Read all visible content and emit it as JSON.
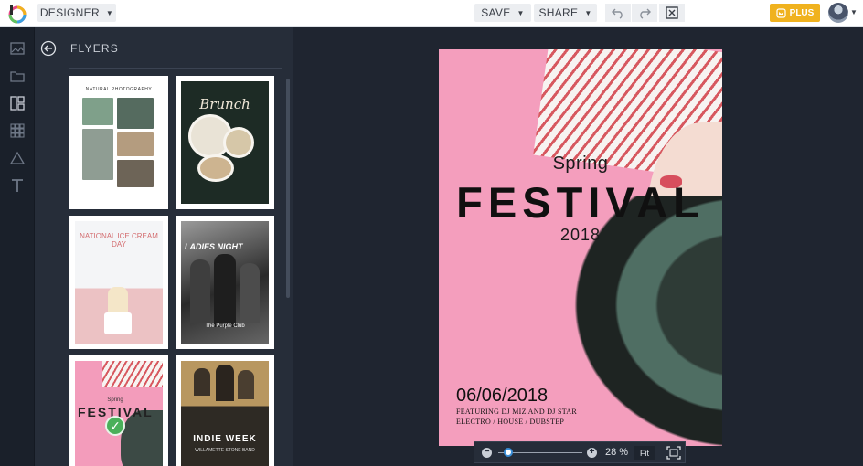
{
  "toolbar": {
    "mode_label": "DESIGNER",
    "save_label": "SAVE",
    "share_label": "SHARE",
    "plus_label": "PLUS"
  },
  "panel": {
    "title": "FLYERS",
    "templates": [
      {
        "name": "Natural Photography",
        "text": "NATURAL PHOTOGRAPHY"
      },
      {
        "name": "Brunch",
        "text": "Brunch"
      },
      {
        "name": "National Ice Cream Day",
        "text": "NATIONAL ICE CREAM DAY"
      },
      {
        "name": "Ladies Night",
        "text": "LADIES NIGHT",
        "sub": "The Purple Club"
      },
      {
        "name": "Spring Festival",
        "text_top": "Spring",
        "text": "FESTIVAL",
        "selected": true
      },
      {
        "name": "Indie Week",
        "text": "INDIE WEEK",
        "sub": "WILLAMETTE STONE BAND"
      }
    ]
  },
  "poster": {
    "kicker": "Spring",
    "headline": "FESTIVAL",
    "year": "2018",
    "date": "06/06/2018",
    "line1": "FEATURING DJ MIZ AND DJ STAR",
    "line2": "ELECTRO / HOUSE / DUBSTEP"
  },
  "zoom": {
    "value": "28 %",
    "level": 0.28,
    "fit_label": "Fit"
  },
  "colors": {
    "accent": "#f0b21e",
    "panel_bg": "#262d39",
    "canvas_bg": "#1f2530",
    "poster_pink": "#f49ebd",
    "selected_check": "#4ab05a"
  },
  "icons": {
    "rail": [
      "photo-icon",
      "folder-icon",
      "layout-icon",
      "grid-icon",
      "shapes-icon",
      "text-icon"
    ]
  }
}
